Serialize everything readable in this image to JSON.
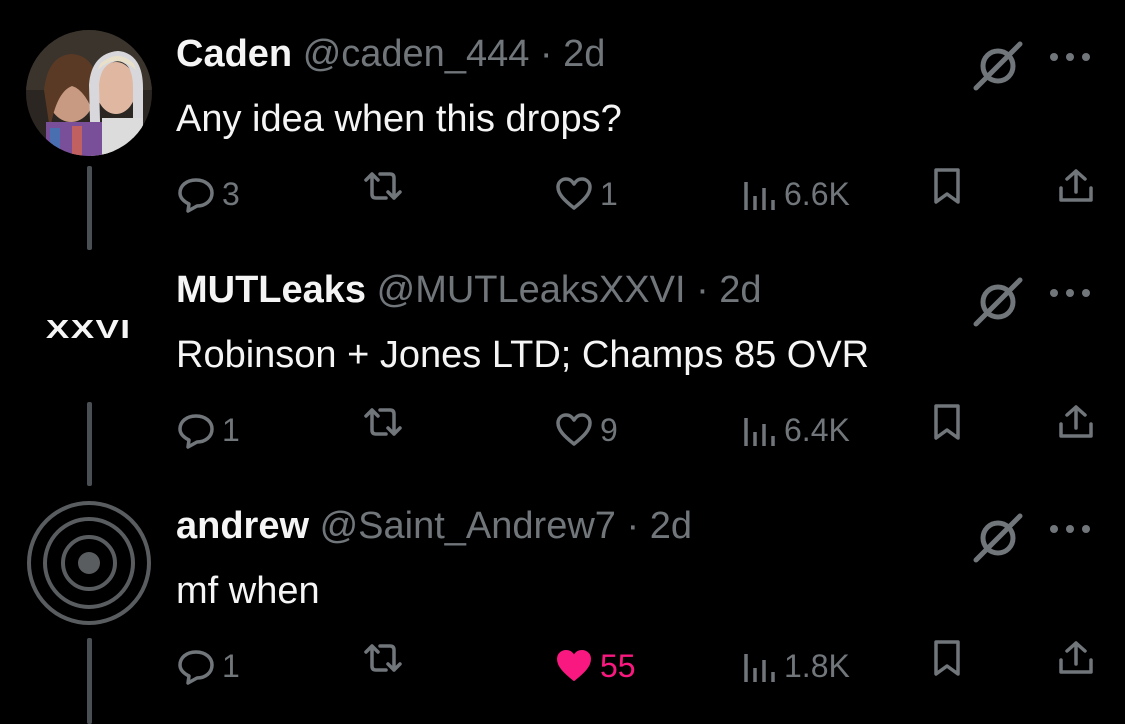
{
  "tweets": [
    {
      "name": "Caden",
      "handle": "@caden_444",
      "dot": "·",
      "time": "2d",
      "text": "Any idea when this drops?",
      "replies": "3",
      "likes": "1",
      "views": "6.6K",
      "liked": false,
      "avatar_type": "photo"
    },
    {
      "name": "MUTLeaks",
      "handle": "@MUTLeaksXXVI",
      "dot": "·",
      "time": "2d",
      "text": "Robinson + Jones LTD; Champs 85 OVR",
      "replies": "1",
      "likes": "9",
      "views": "6.4K",
      "liked": false,
      "avatar_type": "logo",
      "avatar_logo_text": "XXVI"
    },
    {
      "name": "andrew",
      "handle": "@Saint_Andrew7",
      "dot": "·",
      "time": "2d",
      "text": "mf when",
      "replies": "1",
      "likes": "55",
      "views": "1.8K",
      "liked": true,
      "avatar_type": "rings"
    }
  ],
  "icons": {
    "reply": "reply-icon",
    "retweet": "retweet-icon",
    "like": "heart-icon",
    "views": "views-icon",
    "bookmark": "bookmark-icon",
    "share": "share-icon",
    "grok": "grok-icon",
    "more": "more-icon"
  },
  "colors": {
    "background": "#000000",
    "text": "#e7e9ea",
    "muted": "#71767b",
    "like_active": "#f91880"
  }
}
